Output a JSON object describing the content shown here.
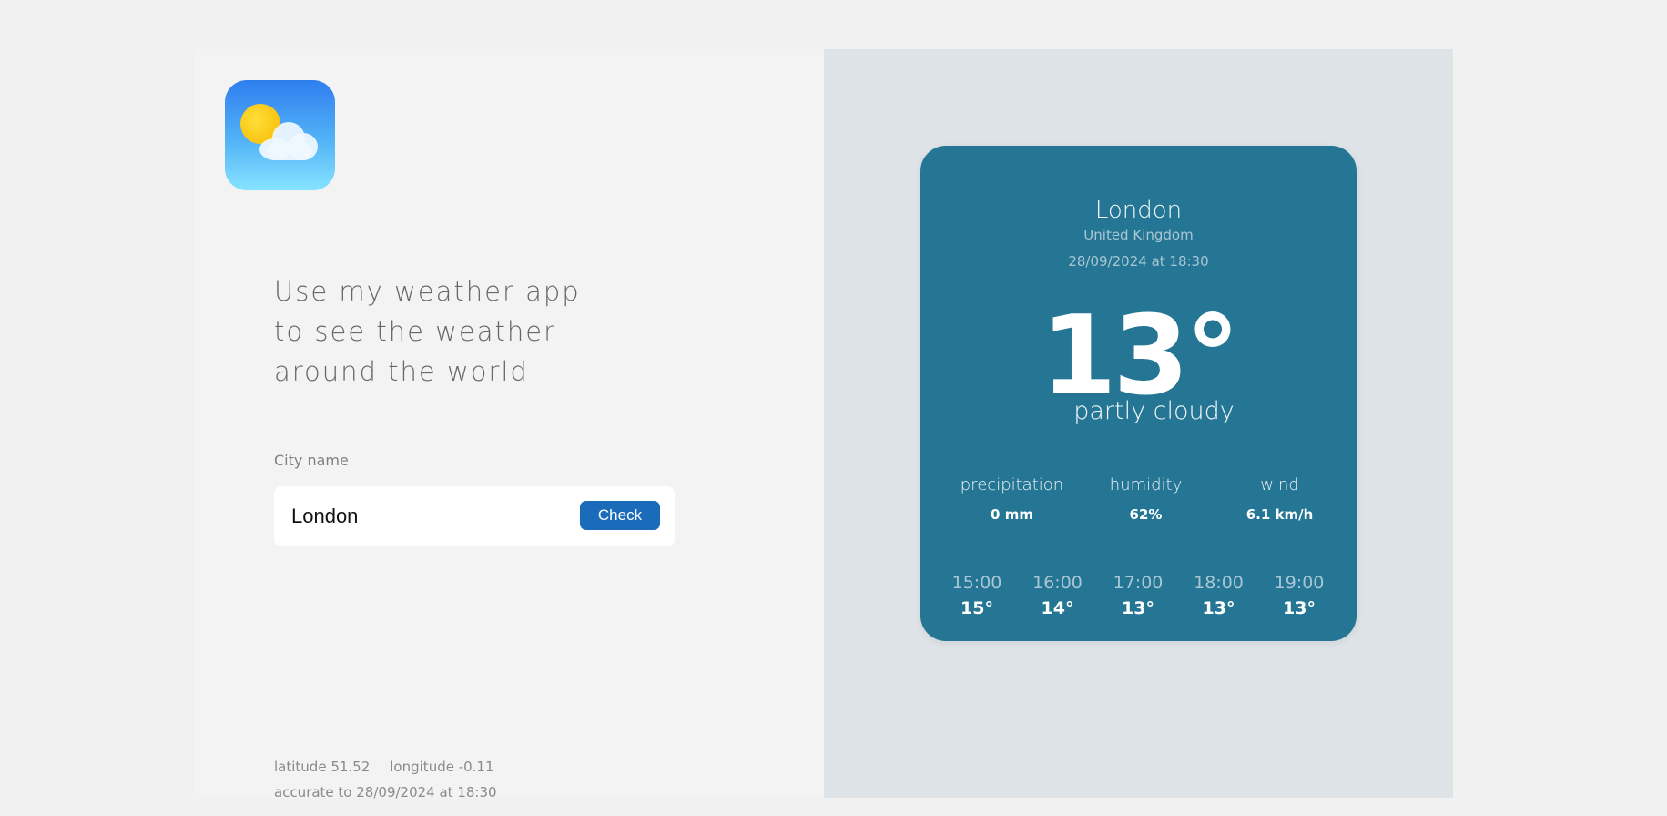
{
  "app": {
    "logo_icon": "weather-partly-cloudy-icon",
    "headline_lines": [
      "Use my weather app",
      "to see the weather",
      "around the world"
    ]
  },
  "search": {
    "label": "City name",
    "value": "London",
    "button_label": "Check"
  },
  "coordinates": {
    "latitude": "latitude 51.52",
    "longitude": "longitude -0.11",
    "accuracy": "accurate to 28/09/2024 at 18:30"
  },
  "weather": {
    "city": "London",
    "country": "United Kingdom",
    "datetime": "28/09/2024 at 18:30",
    "temperature": "13°",
    "condition": "partly cloudy",
    "stats": [
      {
        "label": "precipitation",
        "value": "0 mm"
      },
      {
        "label": "humidity",
        "value": "62%"
      },
      {
        "label": "wind",
        "value": "6.1 km/h"
      }
    ],
    "hourly": [
      {
        "time": "15:00",
        "temp": "15°"
      },
      {
        "time": "16:00",
        "temp": "14°"
      },
      {
        "time": "17:00",
        "temp": "13°"
      },
      {
        "time": "18:00",
        "temp": "13°"
      },
      {
        "time": "19:00",
        "temp": "13°"
      }
    ]
  },
  "colors": {
    "card_background": "#257694",
    "button_background": "#1a6cbb",
    "right_panel_background": "#dde3e6"
  }
}
